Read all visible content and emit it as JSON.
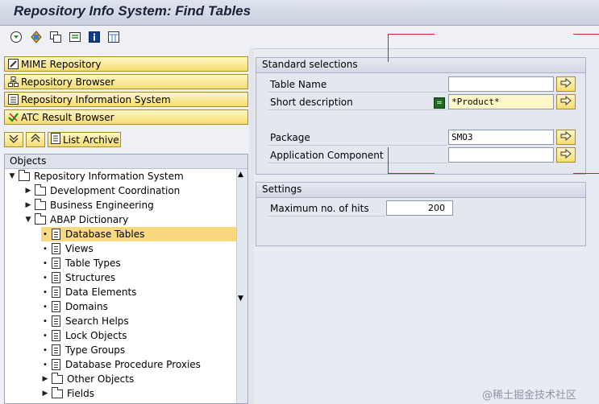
{
  "window": {
    "title": "Repository Info System: Find Tables"
  },
  "toolbar": {
    "icons": [
      "execute-icon",
      "find-icon",
      "copy-icon",
      "variant-icon",
      "info-icon",
      "layout-icon"
    ]
  },
  "nav_buttons": [
    {
      "label": "MIME Repository",
      "icon": "edit-icon"
    },
    {
      "label": "Repository Browser",
      "icon": "hierarchy-icon"
    },
    {
      "label": "Repository Information System",
      "icon": "info-system-icon"
    },
    {
      "label": "ATC Result Browser",
      "icon": "check-icon"
    }
  ],
  "archive": {
    "label": "List Archive"
  },
  "tree": {
    "header": "Objects",
    "root": "Repository Information System",
    "items": [
      {
        "label": "Development Coordination",
        "expanded": false
      },
      {
        "label": "Business Engineering",
        "expanded": false
      },
      {
        "label": "ABAP Dictionary",
        "expanded": true
      }
    ],
    "dictionary_children": [
      "Database Tables",
      "Views",
      "Table Types",
      "Structures",
      "Data Elements",
      "Domains",
      "Search Helps",
      "Lock Objects",
      "Type Groups",
      "Database Procedure Proxies"
    ],
    "selected": "Database Tables",
    "other_objects": "Other Objects",
    "fields": "Fields"
  },
  "standard_selections": {
    "title": "Standard selections",
    "table_name": {
      "label": "Table Name",
      "value": ""
    },
    "short_description": {
      "label": "Short description",
      "value": "*Product*"
    },
    "package": {
      "label": "Package",
      "value": "SMO3"
    },
    "application_component": {
      "label": "Application Component",
      "value": ""
    }
  },
  "settings": {
    "title": "Settings",
    "max_hits": {
      "label": "Maximum no. of hits",
      "value": "200"
    }
  },
  "watermark": "@稀土掘金技术社区",
  "colors": {
    "selected_row": "#f9d87f",
    "button": "#f6dd70",
    "annotation_red": "#d21e1e"
  }
}
